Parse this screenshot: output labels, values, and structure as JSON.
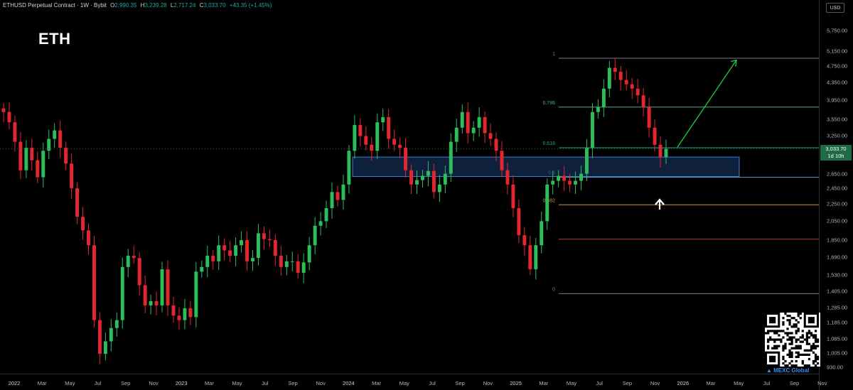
{
  "header": {
    "symbol": "ETHUSD Perpetual Contract · 1W · Bybit",
    "open_key": "O",
    "open": "2,990.35",
    "high_key": "H",
    "high": "3,239.28",
    "low_key": "L",
    "low": "2,717.24",
    "close_key": "C",
    "close": "3,033.70",
    "change": "+43.35 (+1.45%)"
  },
  "title": "ETH",
  "currency": "USD",
  "current_price": {
    "value": "3,033.70",
    "countdown": "1d 10h",
    "color": "#1e6b45"
  },
  "price_axis": [
    "5,750.00",
    "5,150.00",
    "4,750.00",
    "4,350.00",
    "3,950.00",
    "3,550.00",
    "3,250.00",
    "2,650.00",
    "2,450.00",
    "2,250.00",
    "2,050.00",
    "1,850.00",
    "1,690.00",
    "1,530.00",
    "1,405.00",
    "1,285.00",
    "1,185.00",
    "1,085.00",
    "1,005.00",
    "930.00"
  ],
  "time_axis": [
    {
      "label": "2022",
      "year": true
    },
    {
      "label": "Mar"
    },
    {
      "label": "May"
    },
    {
      "label": "Jul"
    },
    {
      "label": "Sep"
    },
    {
      "label": "Nov"
    },
    {
      "label": "2023",
      "year": true
    },
    {
      "label": "Mar"
    },
    {
      "label": "May"
    },
    {
      "label": "Jul"
    },
    {
      "label": "Sep"
    },
    {
      "label": "Nov"
    },
    {
      "label": "2024",
      "year": true
    },
    {
      "label": "Mar"
    },
    {
      "label": "May"
    },
    {
      "label": "Jul"
    },
    {
      "label": "Sep"
    },
    {
      "label": "Nov"
    },
    {
      "label": "2025",
      "year": true
    },
    {
      "label": "Mar"
    },
    {
      "label": "May"
    },
    {
      "label": "Jul"
    },
    {
      "label": "Sep"
    },
    {
      "label": "Nov"
    },
    {
      "label": "2026",
      "year": true
    },
    {
      "label": "Mar"
    },
    {
      "label": "May"
    },
    {
      "label": "Jul"
    },
    {
      "label": "Sep"
    },
    {
      "label": "Nov"
    }
  ],
  "fibonacci": {
    "levels": [
      {
        "ratio": "1",
        "color": "#787b86"
      },
      {
        "ratio": "0.786",
        "color": "#4caf8a"
      },
      {
        "ratio": "0.618",
        "color": "#26a69a"
      },
      {
        "ratio": "0.5",
        "color": "#4c9ab5"
      },
      {
        "ratio": "0.382",
        "color": "#c89a2b"
      },
      {
        "ratio": "0",
        "color": "#787b86"
      }
    ],
    "extra_line_color": "#b23a3a"
  },
  "support_zone": {
    "fill": "#1a3a6e",
    "border": "#3d7bd6"
  },
  "annotations": {
    "arrow_up_color": "#ffffff",
    "projection_color": "#1fcf3a"
  },
  "colors": {
    "bull": "#26a69a",
    "bear": "#f23645",
    "bull_candle": "#2dbd5a",
    "bear_candle": "#e4262e"
  },
  "watermark": {
    "brand": "MEXC Global"
  },
  "chart_data": {
    "type": "candlestick",
    "symbol": "ETHUSD",
    "interval": "1W",
    "ylim": [
      930,
      5750
    ],
    "x_range": [
      "2022-01",
      "2026-12"
    ],
    "scale": "log",
    "weekly_closes_approx": [
      3700,
      3500,
      3150,
      2700,
      3050,
      2850,
      2600,
      3000,
      3200,
      3350,
      3050,
      2800,
      2450,
      2100,
      1950,
      1800,
      1200,
      1000,
      1070,
      1150,
      1200,
      1600,
      1700,
      1680,
      1450,
      1300,
      1330,
      1300,
      1580,
      1300,
      1230,
      1200,
      1280,
      1220,
      1560,
      1600,
      1700,
      1650,
      1800,
      1750,
      1700,
      1800,
      1850,
      1650,
      1680,
      1920,
      1860,
      1850,
      1700,
      1600,
      1650,
      1650,
      1550,
      1640,
      1800,
      2000,
      2050,
      2200,
      2400,
      2300,
      2500,
      3000,
      3450,
      3250,
      3100,
      3000,
      3500,
      3600,
      3200,
      3100,
      3050,
      2700,
      2500,
      2560,
      2620,
      2690,
      2400,
      2500,
      2650,
      3150,
      3400,
      3700,
      3300,
      3400,
      3600,
      3300,
      3200,
      3000,
      2700,
      2500,
      2200,
      1900,
      1800,
      1580,
      1800,
      2050,
      2500,
      2550,
      2620,
      2550,
      2500,
      2550,
      2650,
      3050,
      3700,
      3800,
      4200,
      4700,
      4600,
      4400,
      4300,
      4200,
      4050,
      3800,
      3400,
      3100,
      2900,
      3033.7
    ],
    "fib_levels": [
      {
        "ratio": 1,
        "price": 4950
      },
      {
        "ratio": 0.786,
        "price": 3800
      },
      {
        "ratio": 0.618,
        "price": 3050
      },
      {
        "ratio": 0.5,
        "price": 2600
      },
      {
        "ratio": 0.382,
        "price": 2240
      },
      {
        "ratio": 0,
        "price": 1385
      }
    ],
    "support_zone": [
      2610,
      2900
    ],
    "projection_target": 4900,
    "current_price": 3033.7
  }
}
